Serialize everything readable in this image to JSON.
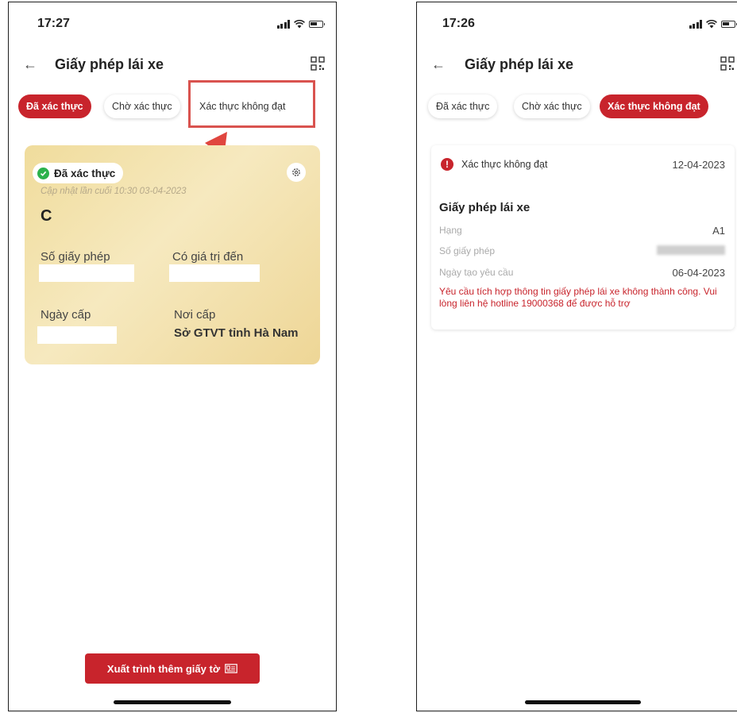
{
  "left": {
    "status_time": "17:27",
    "header": {
      "back": "←",
      "title": "Giấy phép lái xe",
      "qr_icon": "qr-code-icon"
    },
    "tabs": [
      {
        "label": "Đã xác thực",
        "active": true
      },
      {
        "label": "Chờ xác thực",
        "active": false
      },
      {
        "label": "Xác thực không đạt",
        "active": false
      }
    ],
    "card": {
      "status": "Đã xác thực",
      "updated": "Cập nhật lần cuối 10:30 03-04-2023",
      "license_class": "C",
      "license_number_label": "Số giấy phép",
      "valid_until_label": "Có giá trị đến",
      "issue_date_label": "Ngày cấp",
      "issued_by_label": "Nơi cấp",
      "issued_by": "Sở GTVT tỉnh Hà Nam"
    },
    "present_button": "Xuất trình thêm giấy tờ"
  },
  "right": {
    "status_time": "17:26",
    "header": {
      "back": "←",
      "title": "Giấy phép lái xe",
      "qr_icon": "qr-code-icon"
    },
    "tabs": [
      {
        "label": "Đã xác thực",
        "active": false
      },
      {
        "label": "Chờ xác thực",
        "active": false
      },
      {
        "label": "Xác thực không đạt",
        "active": true
      }
    ],
    "result": {
      "status": "Xác thực không đạt",
      "date": "12-04-2023",
      "title": "Giấy phép lái xe",
      "class_label": "Hạng",
      "class_value": "A1",
      "license_number_label": "Số giấy phép",
      "request_date_label": "Ngày tạo yêu cầu",
      "request_date": "06-04-2023",
      "error_message": "Yêu cầu tích hợp thông tin giấy phép lái xe không thành công. Vui lòng liên hệ hotline 19000368 để được hỗ trợ"
    }
  },
  "colors": {
    "accent": "#c8242c",
    "success": "#2bb24c",
    "highlight": "#d9534f"
  }
}
